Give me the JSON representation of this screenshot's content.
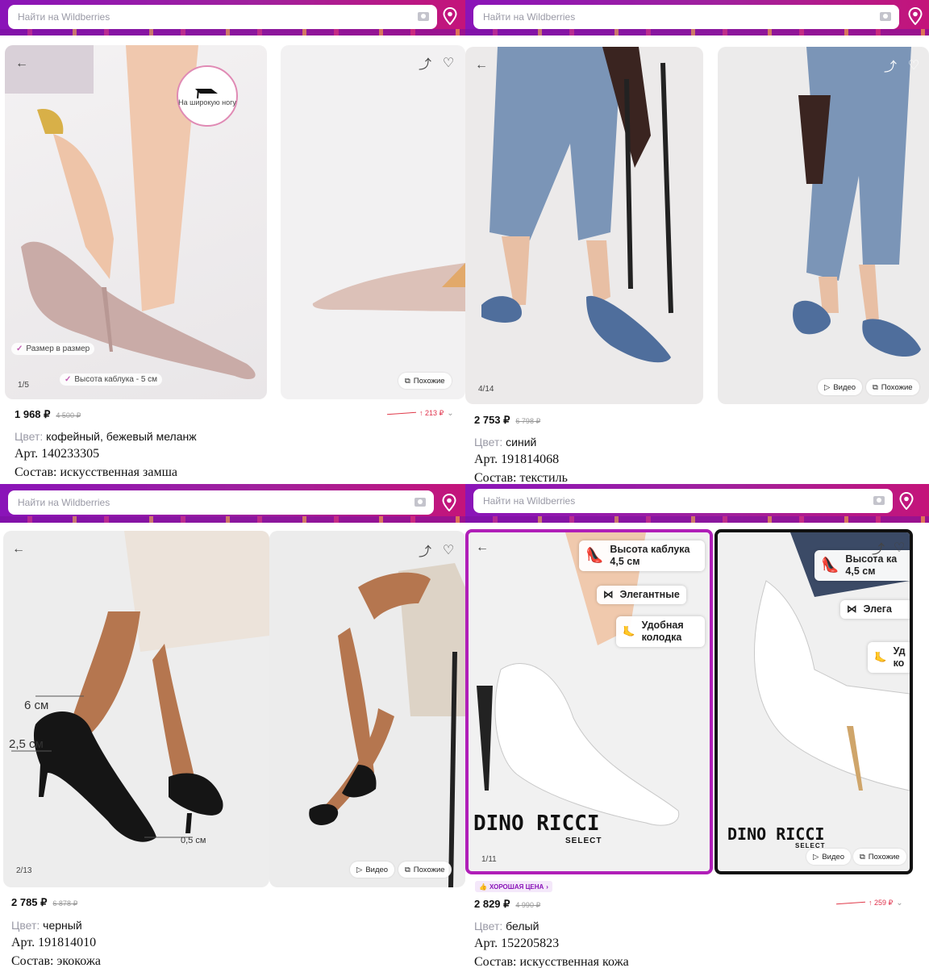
{
  "search": {
    "placeholder": "Найти на Wildberries"
  },
  "labels": {
    "color": "Цвет:",
    "video": "Видео",
    "similar": "Похожие"
  },
  "colors": {
    "brand_purple": "#8a14b8",
    "brand_pink": "#c4147a",
    "trend_red": "#e0304a"
  },
  "panels": [
    {
      "price": "1 968 ₽",
      "old_price": "4 500 ₽",
      "counter": "1/5",
      "price_change": "↑ 213 ₽",
      "badge_wide": "На широкую ногу",
      "tag_size": "Размер в размер",
      "tag_heel": "Высота каблука - 5 см",
      "color": "кофейный, бежевый меланж",
      "article": "Арт. 140233305",
      "composition": "Состав: искусственная замша"
    },
    {
      "price": "2 753 ₽",
      "old_price": "6 798 ₽",
      "counter": "4/14",
      "color": "синий",
      "article": "Арт. 191814068",
      "composition": "Состав: текстиль"
    },
    {
      "price": "2 785 ₽",
      "old_price": "6 878 ₽",
      "counter": "2/13",
      "measure_6": "6 см",
      "measure_25": "2,5 см",
      "measure_05": "0,5 см",
      "color": "черный",
      "article": "Арт. 191814010",
      "composition": "Состав: экокожа"
    },
    {
      "price": "2 829 ₽",
      "old_price": "4 990 ₽",
      "counter": "1/11",
      "price_change": "↑ 259 ₽",
      "good_price": "ХОРОШАЯ ЦЕНА",
      "feature_heel": "Высота каблука 4,5 см",
      "feature_elegant": "Элегантные",
      "feature_last": "Удобная колодка",
      "feature_heel_cropped": "Высота ка 4,5 см",
      "feature_elegant_cropped": "Элега",
      "feature_last_cropped": "Уд ко",
      "brand": "DINO RICCI",
      "brand_sub": "SELECT",
      "color": "белый",
      "article": "Арт. 152205823",
      "composition": "Состав: искусственная кожа"
    }
  ]
}
